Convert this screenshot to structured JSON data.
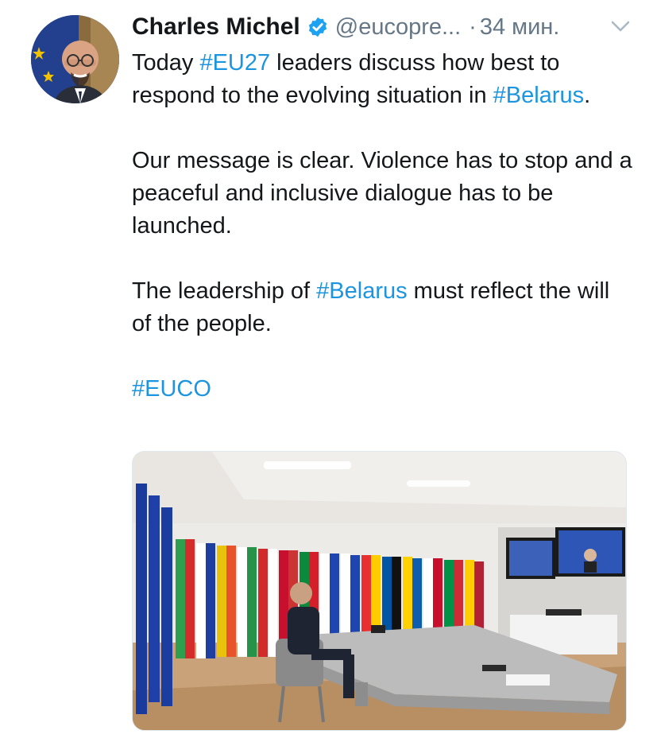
{
  "tweet": {
    "author": {
      "name": "Charles Michel",
      "handle": "@eucopre...",
      "verified": true,
      "avatar": "avatar-photo"
    },
    "time_separator": "·",
    "time": "34 мин.",
    "menu_icon": "chevron-down-icon",
    "text": {
      "p1_a": "Today ",
      "p1_tag1": "#EU27",
      "p1_b": " leaders discuss how best to respond to the evolving situation in ",
      "p1_tag2": "#Belarus",
      "p1_c": ".",
      "p2": "Our message is clear. Violence has to stop and a peaceful and inclusive dialogue has to be launched.",
      "p3_a": "The leadership of ",
      "p3_tag": "#Belarus",
      "p3_b": " must reflect the will of the people.",
      "p4_tag": "#EUCO"
    },
    "media": {
      "type": "photo"
    }
  },
  "colors": {
    "link": "#1b95e0",
    "text": "#14171a",
    "secondary": "#657786",
    "verified": "#1da1f2"
  }
}
